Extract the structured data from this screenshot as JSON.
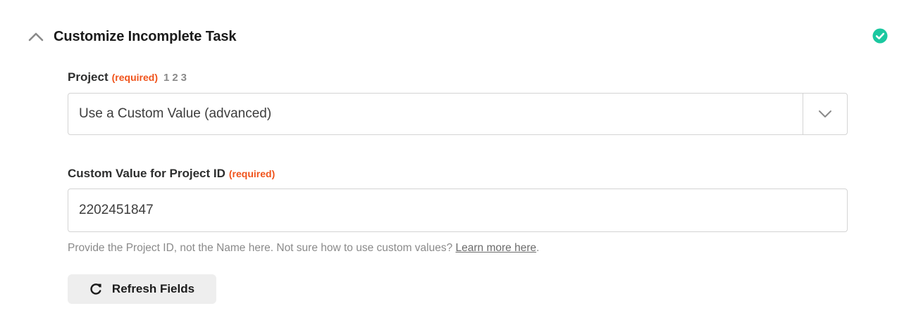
{
  "section": {
    "title": "Customize Incomplete Task",
    "status_color": "#1bc8a0",
    "collapse_icon": "chevron-up-icon",
    "status_icon": "check-circle-icon"
  },
  "project_field": {
    "label": "Project",
    "required_text": "(required)",
    "steps": [
      "1",
      "2",
      "3"
    ],
    "selected_value": "Use a Custom Value (advanced)",
    "toggle_icon": "chevron-down-icon"
  },
  "custom_value_field": {
    "label": "Custom Value for Project ID",
    "required_text": "(required)",
    "value": "2202451847",
    "help_text": "Provide the Project ID, not the Name here. Not sure how to use custom values? ",
    "help_link": "Learn more here",
    "help_suffix": "."
  },
  "refresh_button": {
    "label": "Refresh Fields",
    "icon": "refresh-icon"
  },
  "colors": {
    "required": "#f0531b",
    "muted": "#8a8a8a",
    "border": "#d4d4d4",
    "button_bg": "#eeeeee"
  }
}
